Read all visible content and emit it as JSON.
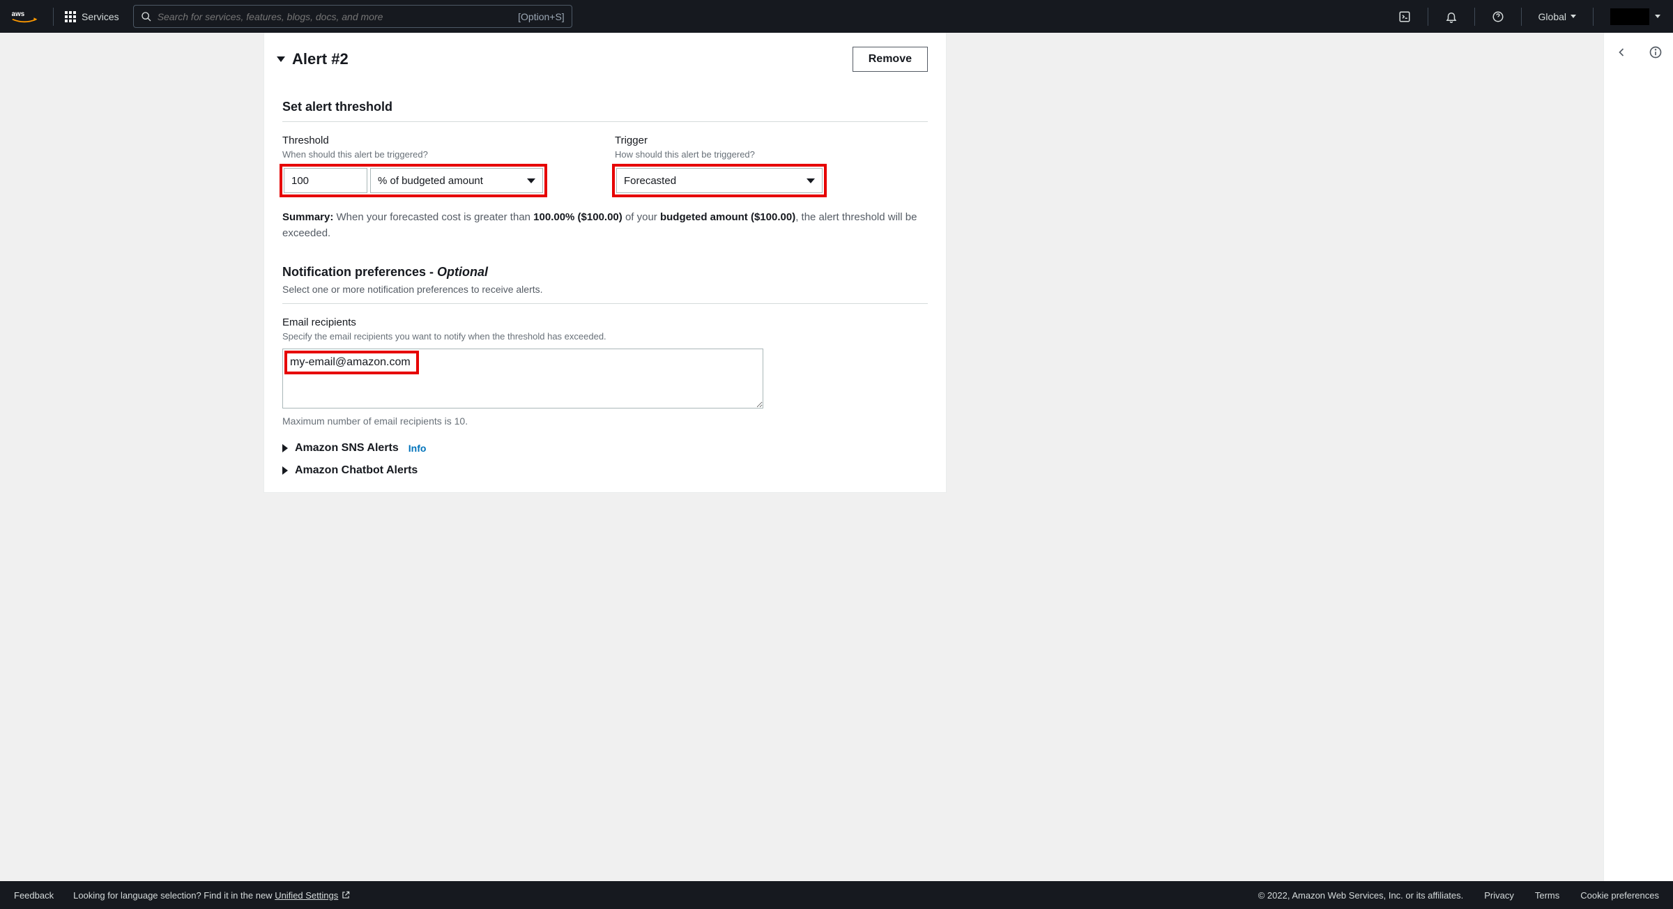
{
  "topbar": {
    "services_label": "Services",
    "search_placeholder": "Search for services, features, blogs, docs, and more",
    "search_kbd": "[Option+S]",
    "region": "Global"
  },
  "panel": {
    "title": "Alert #2",
    "remove_label": "Remove"
  },
  "threshold_section": {
    "heading": "Set alert threshold",
    "threshold_label": "Threshold",
    "threshold_help": "When should this alert be triggered?",
    "threshold_value": "100",
    "threshold_unit": "% of budgeted amount",
    "trigger_label": "Trigger",
    "trigger_help": "How should this alert be triggered?",
    "trigger_value": "Forecasted",
    "summary_prefix": "Summary:",
    "summary_text_1": " When your forecasted cost is greater than ",
    "summary_pct": "100.00% ($100.00)",
    "summary_text_2": " of your ",
    "summary_budget": "budgeted amount ($100.00)",
    "summary_text_3": ", the alert threshold will be exceeded."
  },
  "notif_section": {
    "heading_main": "Notification preferences - ",
    "heading_optional": "Optional",
    "subheading": "Select one or more notification preferences to receive alerts.",
    "email_label": "Email recipients",
    "email_help": "Specify the email recipients you want to notify when the threshold has exceeded.",
    "email_value": "my-email@amazon.com",
    "email_hint": "Maximum number of email recipients is 10.",
    "sns_label": "Amazon SNS Alerts",
    "sns_info": "Info",
    "chatbot_label": "Amazon Chatbot Alerts"
  },
  "footer": {
    "feedback": "Feedback",
    "lang_prompt": "Looking for language selection? Find it in the new ",
    "unified": "Unified Settings",
    "copyright": "© 2022, Amazon Web Services, Inc. or its affiliates.",
    "privacy": "Privacy",
    "terms": "Terms",
    "cookies": "Cookie preferences"
  }
}
